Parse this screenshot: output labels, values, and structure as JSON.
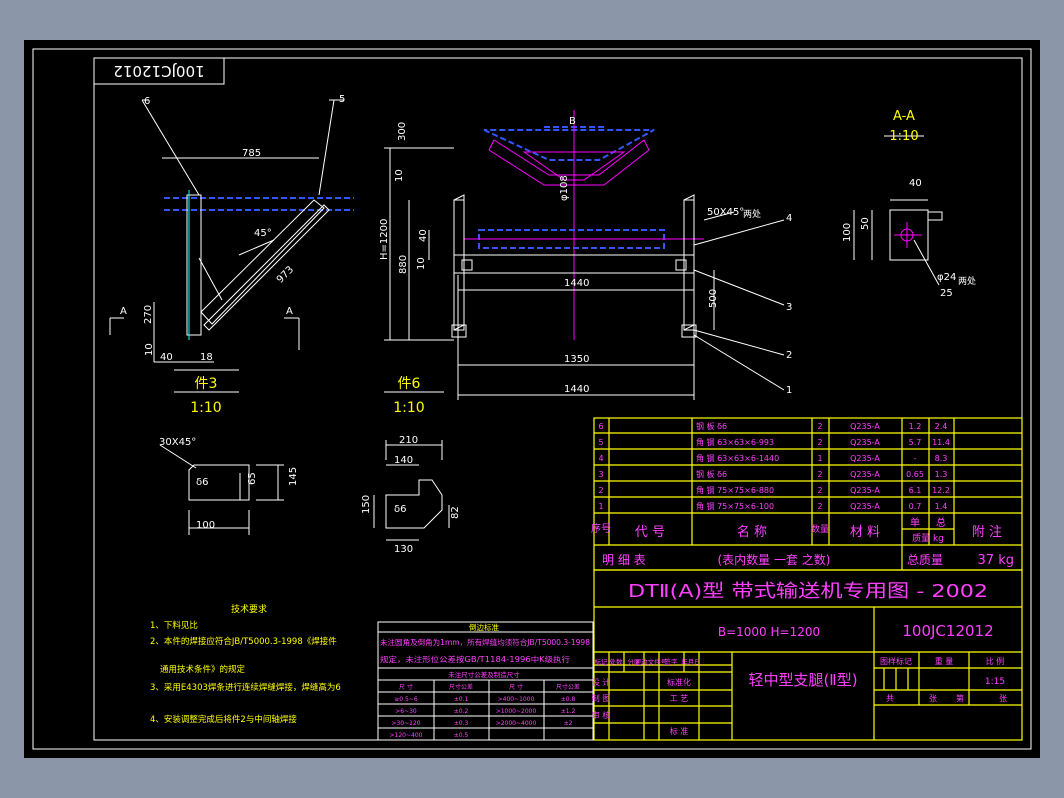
{
  "drawing_number": "100JC12012",
  "drawing_number_mirrored": "100JC12012",
  "views": {
    "part3": {
      "label": "件3",
      "scale": "1:10",
      "dims": [
        "785",
        "45°",
        "973",
        "270",
        "10",
        "40",
        "18"
      ],
      "callouts": [
        "6",
        "5"
      ],
      "section": "A"
    },
    "part6": {
      "label": "件6",
      "scale": "1:10",
      "dims": [
        "300",
        "10",
        "H=1200",
        "880",
        "40",
        "10",
        "B",
        "φ108"
      ]
    },
    "main": {
      "dims": [
        "1440",
        "500",
        "1350",
        "1440",
        "50X45°",
        "两处"
      ],
      "callouts": [
        "4",
        "3",
        "2",
        "1"
      ]
    },
    "section_aa": {
      "label": "A-A",
      "scale": "1:10",
      "dims": [
        "40",
        "50",
        "100",
        "φ24",
        "25",
        "两处"
      ]
    },
    "plate1": {
      "dims": [
        "30X45°",
        "145",
        "65",
        "100"
      ],
      "mark": "δ6"
    },
    "plate2": {
      "dims": [
        "210",
        "140",
        "150",
        "82",
        "130"
      ],
      "mark": "δ6"
    }
  },
  "tech_requirements": {
    "title": "技术要求",
    "items": [
      "1、下料见比",
      "2、本件的焊接应符合JB/T5000.3-1998《焊接件",
      "通用技术条件》的规定",
      "3、采用E4303焊条进行连续焊缝焊接，焊缝高为6",
      "4、安装调整完成后将件2与中间轴焊接"
    ]
  },
  "tolerance_table": {
    "title": "倒边标准",
    "notes": [
      "未注圆角及倒角为1mm，所有焊缝均须符合JB/T5000.3-1998",
      "规定，未注形位公差按GB/T1184-1996中K级执行"
    ],
    "subtitle": "未注尺寸公差及制造尺寸",
    "headers": [
      "尺 寸",
      "尺寸公差",
      "尺 寸",
      "尺寸公差"
    ],
    "rows": [
      [
        "≥0.5~6",
        "±0.1",
        ">400~1000",
        "±0.8"
      ],
      [
        ">6~30",
        "±0.2",
        ">1000~2000",
        "±1.2"
      ],
      [
        ">30~120",
        "±0.3",
        ">2000~4000",
        "±2"
      ],
      [
        ">120~400",
        "±0.5",
        "",
        ""
      ]
    ]
  },
  "bom": {
    "rows": [
      {
        "no": "6",
        "name": "钢 板 δ6",
        "qty": "2",
        "mat": "Q235-A",
        "unit": "1.2",
        "total": "2.4"
      },
      {
        "no": "5",
        "name": "角 钢 63×63×6-993",
        "qty": "2",
        "mat": "Q235-A",
        "unit": "5.7",
        "total": "11.4"
      },
      {
        "no": "4",
        "name": "角 钢 63×63×6-1440",
        "qty": "1",
        "mat": "Q235-A",
        "unit": "-",
        "total": "8.3"
      },
      {
        "no": "3",
        "name": "钢 板 δ6",
        "qty": "2",
        "mat": "Q235-A",
        "unit": "0.65",
        "total": "1.3"
      },
      {
        "no": "2",
        "name": "角 钢 75×75×6-880",
        "qty": "2",
        "mat": "Q235-A",
        "unit": "6.1",
        "total": "12.2"
      },
      {
        "no": "1",
        "name": "角 钢 75×75×6-100",
        "qty": "2",
        "mat": "Q235-A",
        "unit": "0.7",
        "total": "1.4"
      }
    ],
    "header": {
      "no": "序号",
      "code": "代 号",
      "name": "名 称",
      "qty": "数量",
      "mat": "材 料",
      "unit": "单",
      "unit2": "质量 kg",
      "total": "总",
      "remark": "附 注"
    },
    "footer": {
      "label": "明 细 表",
      "note": "(表内数量 一套 之数)",
      "weight_label": "总质量",
      "weight": "37 kg"
    }
  },
  "title_block": {
    "series": "DTⅡ(A)型 带式输送机专用图 - 2002",
    "params": "B=1000 H=1200",
    "code": "100JC12012",
    "name": "轻中型支腿(Ⅱ型)",
    "rev_headers": [
      "标记",
      "处数",
      "分区",
      "更改文件号",
      "签字",
      "年月日"
    ],
    "roles": [
      "设 计",
      "制 图",
      "审 核",
      "标准化",
      "工 艺",
      "标 准"
    ],
    "stage_headers": [
      "图样标记",
      "重 量",
      "比 例"
    ],
    "scale": "1:15",
    "sheet": [
      "共",
      "张",
      "第",
      "张"
    ]
  }
}
